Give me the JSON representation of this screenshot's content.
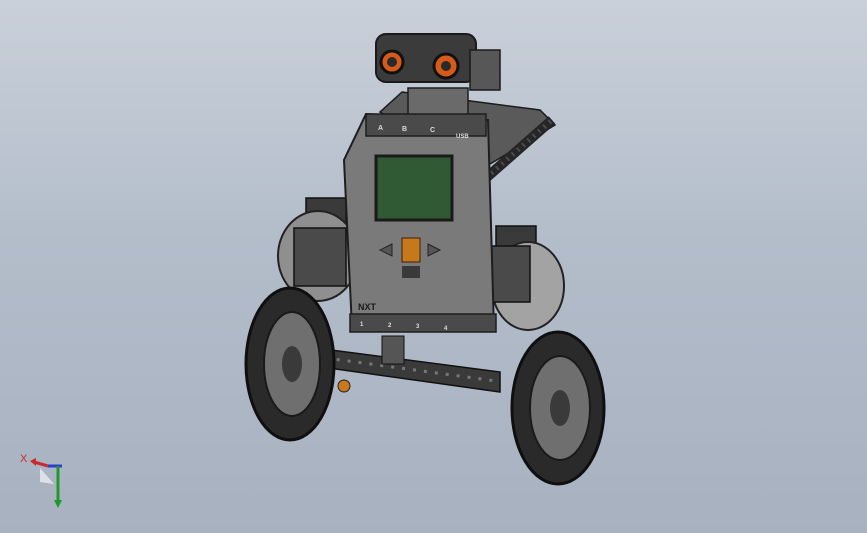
{
  "viewport": {
    "background_top": "#c9d0da",
    "background_bottom": "#a7b1c0"
  },
  "model": {
    "brick_logo": "NXT",
    "port_labels_top": [
      "A",
      "B",
      "C"
    ],
    "usb_label": "USB",
    "port_labels_bottom": [
      "1",
      "2",
      "3",
      "4"
    ],
    "colors": {
      "brick_body": "#7a7a7a",
      "brick_frame": "#4a4a4a",
      "screen": "#2f5a34",
      "orange_button": "#c7781a",
      "wheel_tire": "#2a2a2a",
      "sensor_eyes": "#d65a1a"
    }
  },
  "triad": {
    "x_label": "X",
    "x_color": "#cc2a2a",
    "y_color": "#1f9a2a",
    "z_color": "#2a3fcc"
  }
}
